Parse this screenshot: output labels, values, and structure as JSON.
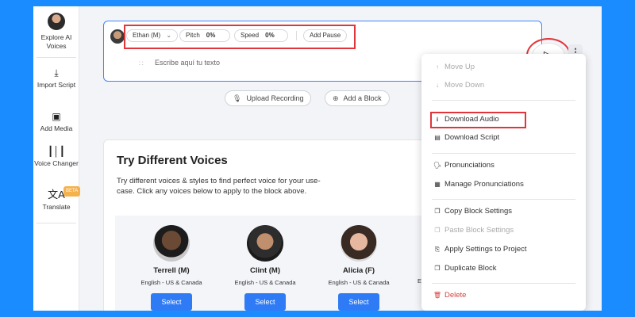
{
  "sidebar": {
    "items": [
      {
        "label": "Explore AI Voices",
        "icon": "voice-avatar-icon"
      },
      {
        "label": "Import Script",
        "icon": "import-icon"
      },
      {
        "label": "Add Media",
        "icon": "media-icon"
      },
      {
        "label": "Voice Changer",
        "icon": "waveform-icon"
      },
      {
        "label": "Translate",
        "icon": "translate-icon",
        "badge": "BETA"
      }
    ]
  },
  "block": {
    "voice_name": "Ethan (M)",
    "pitch_label": "Pitch",
    "pitch_value": "0%",
    "speed_label": "Speed",
    "speed_value": "0%",
    "add_pause_label": "Add Pause",
    "text_placeholder": "Escribe aquí tu texto"
  },
  "actions": {
    "upload_label": "Upload Recording",
    "add_block_label": "Add a Block"
  },
  "voices_card": {
    "title": "Try Different Voices",
    "description": "Try different voices & styles to find perfect voice for your use-case. Click any voices below to apply to the block above.",
    "voices": [
      {
        "name": "Terrell (M)",
        "lang": "English - US & Canada",
        "button": "Select"
      },
      {
        "name": "Clint (M)",
        "lang": "English - US & Canada",
        "button": "Select"
      },
      {
        "name": "Alicia (F)",
        "lang": "English - US & Canada",
        "button": "Select"
      }
    ],
    "partial_text": "E"
  },
  "menu": {
    "move_up": "Move Up",
    "move_down": "Move Down",
    "download_audio": "Download Audio",
    "download_script": "Download Script",
    "pronunciations": "Pronunciations",
    "manage_pronunciations": "Manage Pronunciations",
    "copy_settings": "Copy Block Settings",
    "paste_settings": "Paste Block Settings",
    "apply_to_project": "Apply Settings to Project",
    "duplicate": "Duplicate Block",
    "delete": "Delete"
  },
  "colors": {
    "background": "#1a8cff",
    "accent": "#2f7bf5",
    "highlight": "#e0353b",
    "danger": "#d94141"
  }
}
